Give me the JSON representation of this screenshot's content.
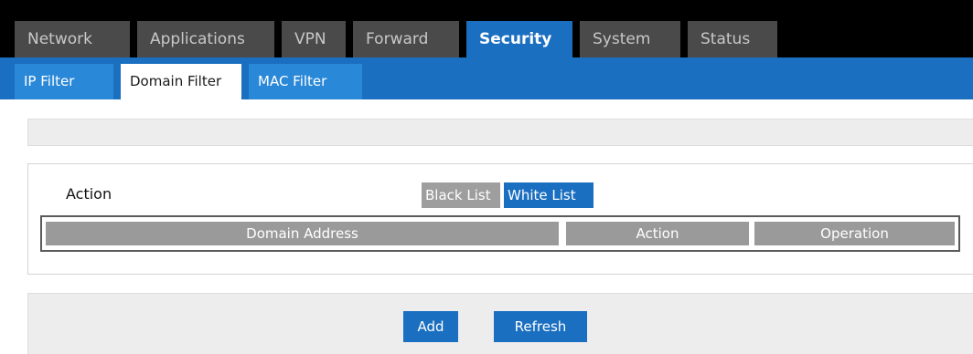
{
  "main_tabs": [
    {
      "label": "Network"
    },
    {
      "label": "Applications"
    },
    {
      "label": "VPN"
    },
    {
      "label": "Forward"
    },
    {
      "label": "Security"
    },
    {
      "label": "System"
    },
    {
      "label": "Status"
    }
  ],
  "active_main_tab": "Security",
  "sub_tabs": [
    {
      "label": "IP Filter"
    },
    {
      "label": "Domain Filter"
    },
    {
      "label": "MAC Filter"
    }
  ],
  "active_sub_tab": "Domain Filter",
  "filter": {
    "action_label": "Action",
    "black_list_label": "Black List",
    "white_list_label": "White List",
    "selected": "White List"
  },
  "table": {
    "headers": [
      "Domain Address",
      "Action",
      "Operation"
    ]
  },
  "buttons": {
    "add_label": "Add",
    "refresh_label": "Refresh"
  },
  "colors": {
    "accent": "#1a6fc0",
    "tab_inactive": "#4a4a4a",
    "header_cell": "#9a9a9a"
  }
}
